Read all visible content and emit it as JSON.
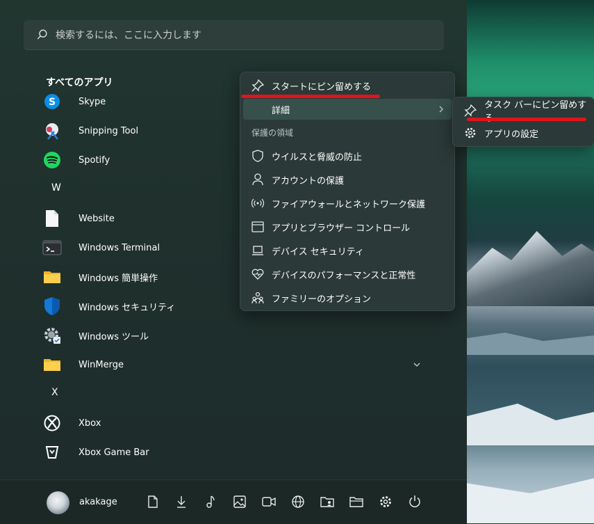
{
  "search": {
    "placeholder": "検索するには、ここに入力します"
  },
  "all_apps": {
    "title": "すべてのアプリ"
  },
  "apps": [
    {
      "label": "Skype",
      "icon": "skype-icon"
    },
    {
      "label": "Snipping Tool",
      "icon": "snipping-tool-icon"
    },
    {
      "label": "Spotify",
      "icon": "spotify-icon"
    },
    {
      "letter": "W"
    },
    {
      "label": "Website",
      "icon": "document-icon"
    },
    {
      "label": "Windows Terminal",
      "icon": "terminal-icon"
    },
    {
      "label": "Windows 簡単操作",
      "icon": "folder-icon"
    },
    {
      "label": "Windows セキュリティ",
      "icon": "shield-icon"
    },
    {
      "label": "Windows ツール",
      "icon": "gear-icon"
    },
    {
      "label": "WinMerge",
      "icon": "folder-icon"
    },
    {
      "letter": "X"
    },
    {
      "label": "Xbox",
      "icon": "xbox-icon"
    },
    {
      "label": "Xbox Game Bar",
      "icon": "xbox-game-bar-icon"
    }
  ],
  "context_menu": {
    "pin_start": "スタートにピン留めする",
    "more": "詳細",
    "group_label": "保護の領域",
    "items": [
      {
        "label": "ウイルスと脅威の防止",
        "icon": "shield-outline-icon"
      },
      {
        "label": "アカウントの保護",
        "icon": "person-icon"
      },
      {
        "label": "ファイアウォールとネットワーク保護",
        "icon": "network-icon"
      },
      {
        "label": "アプリとブラウザー コントロール",
        "icon": "browser-window-icon"
      },
      {
        "label": "デバイス セキュリティ",
        "icon": "laptop-icon"
      },
      {
        "label": "デバイスのパフォーマンスと正常性",
        "icon": "heart-icon"
      },
      {
        "label": "ファミリーのオプション",
        "icon": "family-icon"
      }
    ]
  },
  "submenu": {
    "pin_taskbar": "タスク バーにピン留めする",
    "app_settings": "アプリの設定"
  },
  "footer": {
    "username": "akakage",
    "buttons": [
      "document-icon",
      "download-icon",
      "music-icon",
      "picture-icon",
      "video-icon",
      "network-globe-icon",
      "folder-user-icon",
      "folder-open-icon",
      "settings-icon",
      "power-icon"
    ]
  },
  "colors": {
    "highlight_red": "#e0141c",
    "accent_green": "#22c55e"
  }
}
